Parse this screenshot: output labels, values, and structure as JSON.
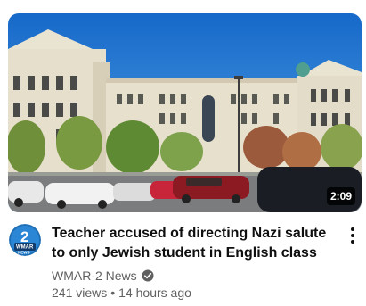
{
  "video": {
    "duration": "2:09",
    "title": "Teacher accused of directing Nazi salute to only Jewish student in English class",
    "channel": "WMAR-2 News",
    "views": "241 views",
    "separator": "•",
    "age": "14 hours ago"
  },
  "avatar": {
    "number": "2",
    "logo_text": "WMAR",
    "logo_sub": "NEWS",
    "icon": "channel-avatar-icon"
  },
  "icons": {
    "verified": "verified-check-icon",
    "more": "more-vertical-icon"
  },
  "colors": {
    "title": "#0f0f0f",
    "secondary": "#606060",
    "avatar_bg": "#1f6fb5"
  }
}
